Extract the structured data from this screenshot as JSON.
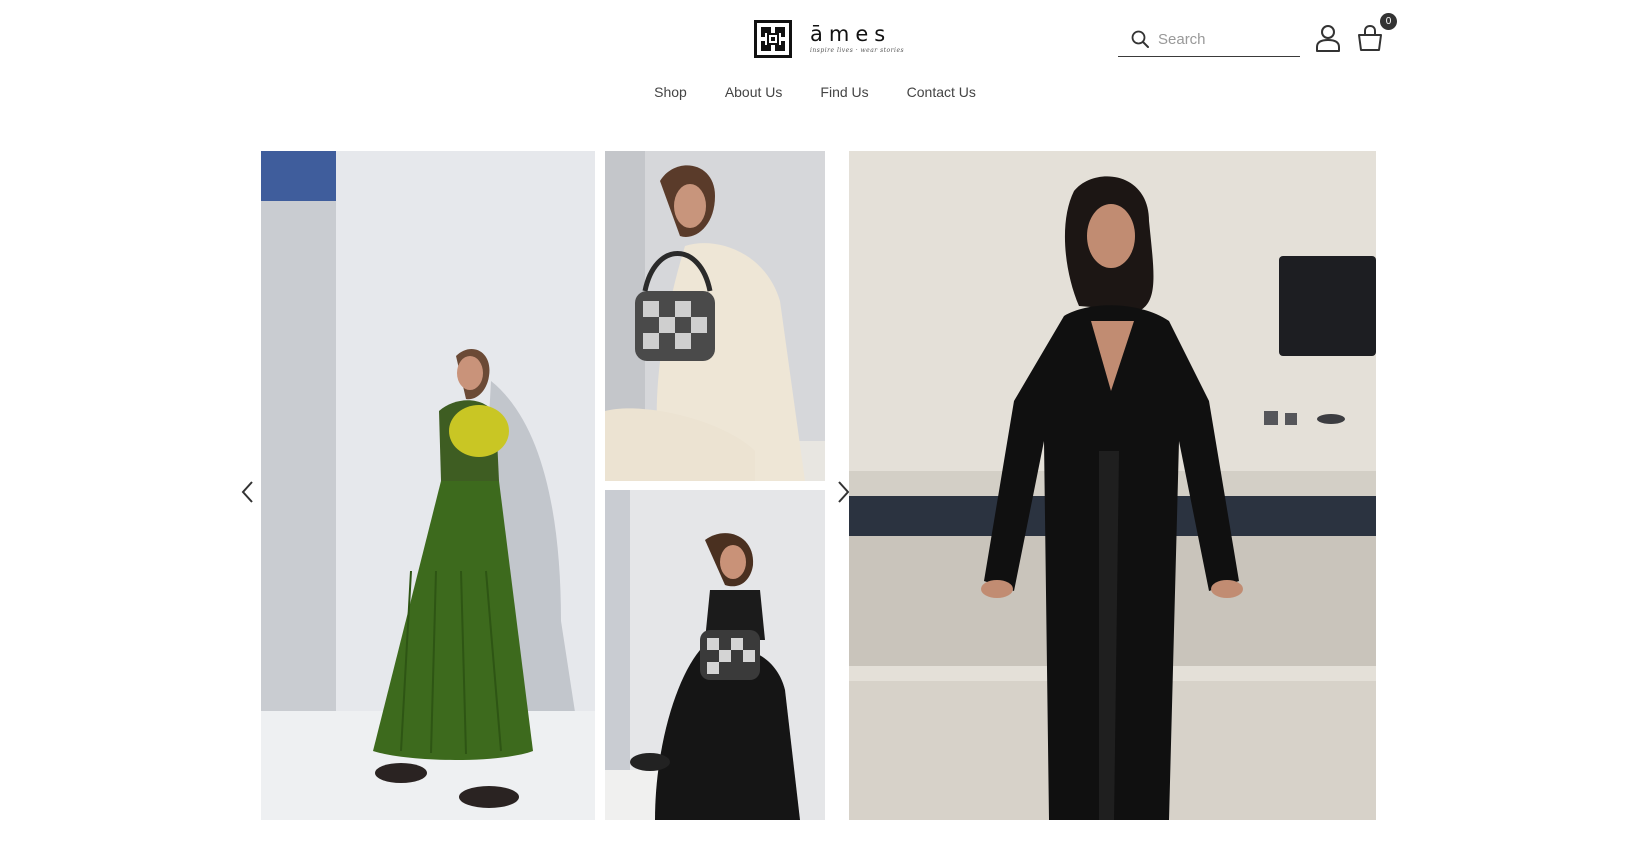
{
  "brand": {
    "name": "āmes",
    "tagline": "inspire lives · wear stories"
  },
  "search": {
    "placeholder": "Search",
    "value": ""
  },
  "cart": {
    "count": "0"
  },
  "nav": {
    "items": [
      {
        "label": "Shop"
      },
      {
        "label": "About Us"
      },
      {
        "label": "Find Us"
      },
      {
        "label": "Contact Us"
      }
    ]
  },
  "icons": {
    "search": "search-icon",
    "account": "user-icon",
    "cart": "shopping-bag-icon",
    "prev": "chevron-left-icon",
    "next": "chevron-right-icon"
  },
  "colors": {
    "text": "#333333",
    "accent": "#1a1a1a",
    "background": "#ffffff"
  }
}
